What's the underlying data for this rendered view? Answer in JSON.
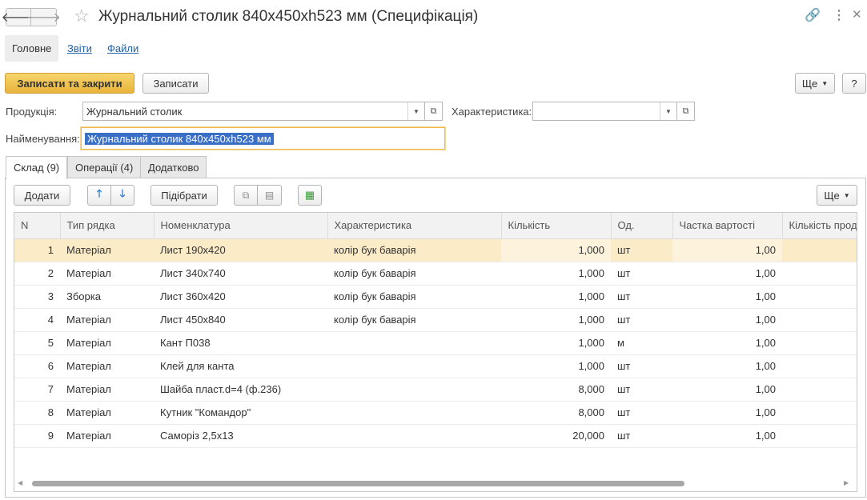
{
  "window": {
    "title": "Журнальний столик 840х450хh523 мм (Специфікація)"
  },
  "top_tabs": {
    "main": "Головне",
    "reports": "Звіти",
    "files": "Файли"
  },
  "toolbar": {
    "save_close": "Записати та закрити",
    "save": "Записати",
    "more": "Ще",
    "help": "?"
  },
  "form": {
    "product_label": "Продукція:",
    "product_value": "Журнальний столик",
    "characteristic_label": "Характеристика:",
    "characteristic_value": "",
    "name_label": "Найменування:",
    "name_value": "Журнальний столик 840х450хh523 мм"
  },
  "tabs": {
    "warehouse": "Склад (9)",
    "operations": "Операції (4)",
    "additional": "Додатково"
  },
  "table_toolbar": {
    "add": "Додати",
    "pick": "Підібрати",
    "more": "Ще"
  },
  "table": {
    "headers": [
      "N",
      "Тип рядка",
      "Номенклатура",
      "Характеристика",
      "Кількість",
      "Од.",
      "Частка вартості",
      "Кількість прод"
    ],
    "rows": [
      {
        "n": "1",
        "type": "Матеріал",
        "item": "Лист 190х420",
        "char": "колір бук баварія",
        "qty": "1,000",
        "unit": "шт",
        "share": "1,00"
      },
      {
        "n": "2",
        "type": "Матеріал",
        "item": "Лист 340х740",
        "char": "колір бук баварія",
        "qty": "1,000",
        "unit": "шт",
        "share": "1,00"
      },
      {
        "n": "3",
        "type": "Зборка",
        "item": "Лист 360х420",
        "char": "колір бук баварія",
        "qty": "1,000",
        "unit": "шт",
        "share": "1,00"
      },
      {
        "n": "4",
        "type": "Матеріал",
        "item": "Лист 450х840",
        "char": "колір бук баварія",
        "qty": "1,000",
        "unit": "шт",
        "share": "1,00"
      },
      {
        "n": "5",
        "type": "Матеріал",
        "item": "Кант П038",
        "char": "",
        "qty": "1,000",
        "unit": "м",
        "share": "1,00"
      },
      {
        "n": "6",
        "type": "Матеріал",
        "item": "Клей для канта",
        "char": "",
        "qty": "1,000",
        "unit": "шт",
        "share": "1,00"
      },
      {
        "n": "7",
        "type": "Матеріал",
        "item": "Шайба пласт.d=4 (ф.236)",
        "char": "",
        "qty": "8,000",
        "unit": "шт",
        "share": "1,00"
      },
      {
        "n": "8",
        "type": "Матеріал",
        "item": "Кутник \"Командор\"",
        "char": "",
        "qty": "8,000",
        "unit": "шт",
        "share": "1,00"
      },
      {
        "n": "9",
        "type": "Матеріал",
        "item": "Саморіз 2,5х13",
        "char": "",
        "qty": "20,000",
        "unit": "шт",
        "share": "1,00"
      }
    ]
  },
  "colors": {
    "primary_button": "#e9b43c",
    "selected_row": "#fcebc7",
    "link": "#1d5fa8",
    "selection": "#3a6fc7"
  }
}
